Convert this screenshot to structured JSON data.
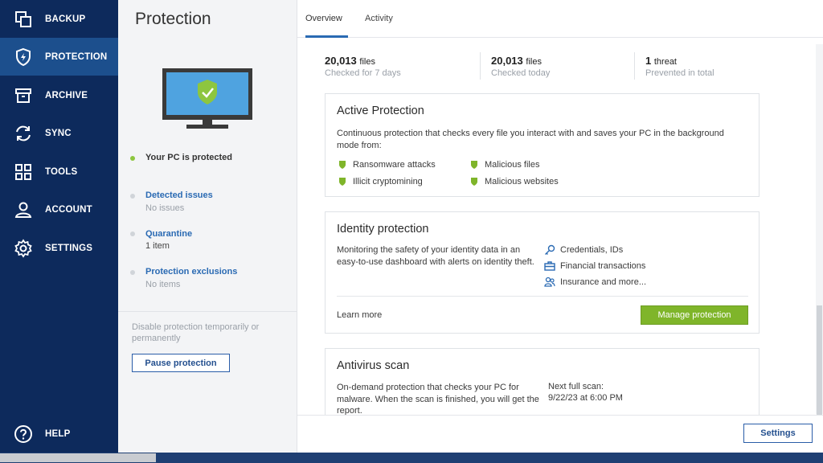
{
  "sidebar": {
    "items": [
      {
        "label": "BACKUP",
        "icon": "backup-icon"
      },
      {
        "label": "PROTECTION",
        "icon": "shield-icon",
        "active": true
      },
      {
        "label": "ARCHIVE",
        "icon": "archive-icon"
      },
      {
        "label": "SYNC",
        "icon": "sync-icon"
      },
      {
        "label": "TOOLS",
        "icon": "tools-grid-icon"
      },
      {
        "label": "ACCOUNT",
        "icon": "account-icon"
      },
      {
        "label": "SETTINGS",
        "icon": "gear-icon"
      }
    ],
    "help": {
      "label": "HELP",
      "icon": "help-icon"
    }
  },
  "panel": {
    "title": "Protection",
    "status": "Your PC is protected",
    "detected_issues": {
      "title": "Detected issues",
      "value": "No issues"
    },
    "quarantine": {
      "title": "Quarantine",
      "value": "1 item"
    },
    "exclusions": {
      "title": "Protection exclusions",
      "value": "No items"
    },
    "disable_text": "Disable protection temporarily or permanently",
    "pause_button": "Pause protection"
  },
  "tabs": [
    "Overview",
    "Activity"
  ],
  "stats": [
    {
      "num": "20,013",
      "unit": "files",
      "sub": "Checked for 7 days"
    },
    {
      "num": "20,013",
      "unit": "files",
      "sub": "Checked today"
    },
    {
      "num": "1",
      "unit": "threat",
      "sub": "Prevented in total"
    }
  ],
  "active_protection": {
    "title": "Active Protection",
    "description": "Continuous protection that checks every file you interact with and saves your PC in the background mode from:",
    "features": [
      "Ransomware attacks",
      "Malicious files",
      "Illicit cryptomining",
      "Malicious websites"
    ]
  },
  "identity_protection": {
    "title": "Identity protection",
    "description": "Monitoring the safety of your identity data in an easy-to-use dashboard with alerts on identity theft.",
    "features": [
      {
        "label": "Credentials, IDs",
        "icon": "key-icon"
      },
      {
        "label": "Financial transactions",
        "icon": "briefcase-icon"
      },
      {
        "label": "Insurance and more...",
        "icon": "people-icon"
      }
    ],
    "learn_more": "Learn more",
    "manage_button": "Manage protection"
  },
  "antivirus_scan": {
    "title": "Antivirus scan",
    "description": "On-demand protection that checks your PC for malware. When the scan is finished, you will get the report.",
    "next_scan_label": "Next full scan:",
    "next_scan_value": "9/22/23 at 6:00 PM"
  },
  "settings_button": "Settings",
  "colors": {
    "sidebar": "#0d2a5c",
    "active": "#1c4f8d",
    "accent_green": "#7fb52a",
    "link": "#2a6ab3"
  }
}
